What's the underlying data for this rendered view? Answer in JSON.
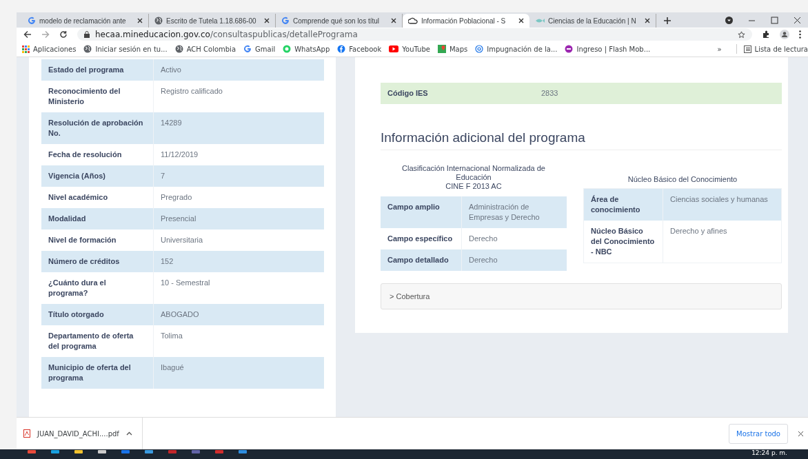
{
  "tabs": [
    {
      "title": "modelo de reclamación ante",
      "selected": false
    },
    {
      "title": "Escrito de Tutela 1.18.686-00",
      "selected": false
    },
    {
      "title": "Comprende qué son los títul",
      "selected": false
    },
    {
      "title": "Información Poblacional - S",
      "selected": true
    },
    {
      "title": "Ciencias de la Educación | N",
      "selected": false
    }
  ],
  "address": {
    "host": "hecaa.mineducacion.gov.co",
    "path": "/consultaspublicas/detallePrograma"
  },
  "bookmarks": [
    {
      "label": "Aplicaciones"
    },
    {
      "label": "Iniciar sesión en tu..."
    },
    {
      "label": "ACH Colombia"
    },
    {
      "label": "Gmail"
    },
    {
      "label": "WhatsApp"
    },
    {
      "label": "Facebook"
    },
    {
      "label": "YouTube"
    },
    {
      "label": "Maps"
    },
    {
      "label": "Impugnación de la..."
    },
    {
      "label": "Ingreso | Flash Mob..."
    }
  ],
  "bookmarks_more": "»",
  "reading_list": "Lista de lectura",
  "program_table": [
    {
      "label": "Estado del programa",
      "value": "Activo"
    },
    {
      "label": "Reconocimiento del Ministerio",
      "value": "Registro calificado"
    },
    {
      "label": "Resolución de aprobación No.",
      "value": "14289"
    },
    {
      "label": "Fecha de resolución",
      "value": "11/12/2019"
    },
    {
      "label": "Vigencia (Años)",
      "value": "7"
    },
    {
      "label": "Nivel académico",
      "value": "Pregrado"
    },
    {
      "label": "Modalidad",
      "value": "Presencial"
    },
    {
      "label": "Nivel de formación",
      "value": "Universitaria"
    },
    {
      "label": "Número de créditos",
      "value": "152"
    },
    {
      "label": "¿Cuánto dura el programa?",
      "value": "10 - Semestral"
    },
    {
      "label": "Título otorgado",
      "value": "ABOGADO"
    },
    {
      "label": "Departamento de oferta del programa",
      "value": "Tolima"
    },
    {
      "label": "Municipio de oferta del programa",
      "value": "Ibagué"
    }
  ],
  "institution_row": {
    "label": "Código IES",
    "value": "2833"
  },
  "additional_heading": "Información adicional del programa",
  "cine": {
    "caption": [
      "Clasificación Internacional Normalizada de",
      "Educación",
      "CINE F 2013 AC"
    ],
    "rows": [
      {
        "label": "Campo amplio",
        "value": "Administración de Empresas y Derecho"
      },
      {
        "label": "Campo específico",
        "value": "Derecho"
      },
      {
        "label": "Campo detallado",
        "value": "Derecho"
      }
    ]
  },
  "nbc": {
    "caption": "Núcleo Básico del Conocimiento",
    "rows": [
      {
        "label": "Área de conocimiento",
        "value": "Ciencias sociales y humanas"
      },
      {
        "label": "Núcleo Básico del Conocimiento - NBC",
        "value": "Derecho y afines"
      }
    ]
  },
  "accordion": {
    "label": "> Cobertura"
  },
  "download": {
    "file": "JUAN_DAVID_ACHI....pdf",
    "show_all": "Mostrar todo"
  },
  "clock": "12:24 p. m."
}
